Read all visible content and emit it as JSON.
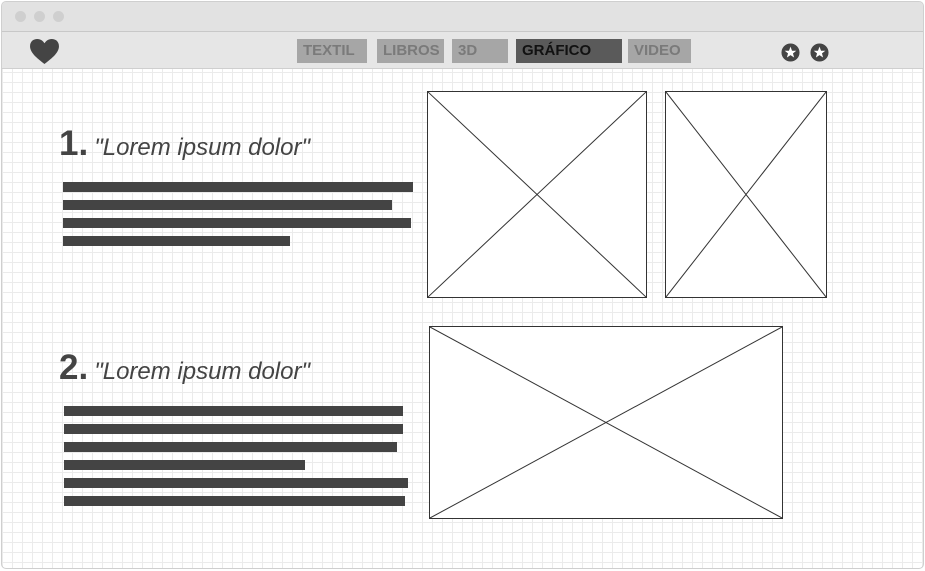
{
  "window": {
    "controls": [
      "close-dot",
      "minimize-dot",
      "maximize-dot"
    ]
  },
  "navbar": {
    "logo_icon": "heart-icon",
    "tabs": [
      {
        "label": "TEXTIL",
        "active": false
      },
      {
        "label": "LIBROS",
        "active": false
      },
      {
        "label": "3D",
        "active": false
      },
      {
        "label": "GRÁFICO",
        "active": true
      },
      {
        "label": "VIDEO",
        "active": false
      }
    ],
    "right_icons": [
      "star-icon",
      "star-icon"
    ]
  },
  "sections": [
    {
      "number": "1.",
      "title": "\"Lorem ipsum dolor\"",
      "text_line_count": 4,
      "image_placeholders": 2
    },
    {
      "number": "2.",
      "title": "\"Lorem ipsum dolor\"",
      "text_line_count": 6,
      "image_placeholders": 1
    }
  ],
  "colors": {
    "tab_inactive_bg": "#a6a6a6",
    "tab_active_bg": "#5a5a5a",
    "text_dark": "#444444",
    "grid": "#ebebeb"
  }
}
